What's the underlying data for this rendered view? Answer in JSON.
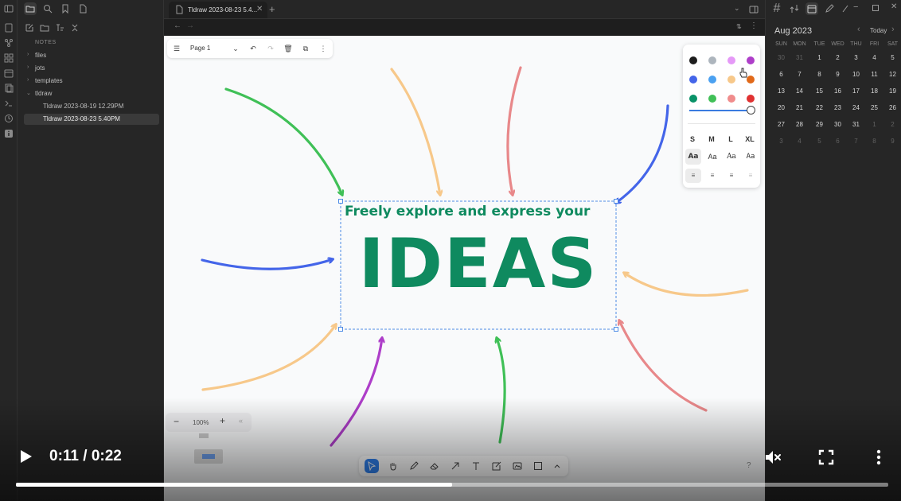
{
  "sidebar": {
    "header": "NOTES",
    "items": [
      {
        "label": "files",
        "type": "folder"
      },
      {
        "label": "jots",
        "type": "folder"
      },
      {
        "label": "templates",
        "type": "folder"
      },
      {
        "label": "tldraw",
        "type": "folder",
        "expanded": true
      },
      {
        "label": "Tldraw 2023-08-19 12.29PM",
        "type": "file"
      },
      {
        "label": "Tldraw 2023-08-23 5.40PM",
        "type": "file",
        "selected": true
      }
    ]
  },
  "tab": {
    "title": "Tldraw 2023-08-23 5.4..."
  },
  "canvas": {
    "page_label": "Page 1",
    "zoom": "100%",
    "heading": "Freely explore and express your",
    "big_text": "IDEAS",
    "text_color": "#0f8a5f",
    "style_panel": {
      "colors": [
        "#1d1d1d",
        "#adb5bd",
        "#e599f7",
        "#ae3ec9",
        "#4465e9",
        "#4ba1f1",
        "#f7c88a",
        "#e16919",
        "#099268",
        "#40c057",
        "#f08c8c",
        "#e03131"
      ],
      "sizes": [
        "S",
        "M",
        "L",
        "XL"
      ],
      "fonts": [
        "Aa",
        "Aa",
        "Aa",
        "Aa"
      ]
    }
  },
  "calendar": {
    "month": "Aug 2023",
    "today_label": "Today",
    "weekdays": [
      "SUN",
      "MON",
      "TUE",
      "WED",
      "THU",
      "FRI",
      "SAT"
    ],
    "weeks": [
      [
        "30",
        "31",
        "1",
        "2",
        "3",
        "4",
        "5"
      ],
      [
        "6",
        "7",
        "8",
        "9",
        "10",
        "11",
        "12"
      ],
      [
        "13",
        "14",
        "15",
        "16",
        "17",
        "18",
        "19"
      ],
      [
        "20",
        "21",
        "22",
        "23",
        "24",
        "25",
        "26"
      ],
      [
        "27",
        "28",
        "29",
        "30",
        "31",
        "1",
        "2"
      ],
      [
        "3",
        "4",
        "5",
        "6",
        "7",
        "8",
        "9"
      ]
    ],
    "dim_prefix": 2,
    "dim_suffix_from_week": 4
  },
  "video": {
    "time": "0:11 / 0:22",
    "progress": 0.5
  }
}
